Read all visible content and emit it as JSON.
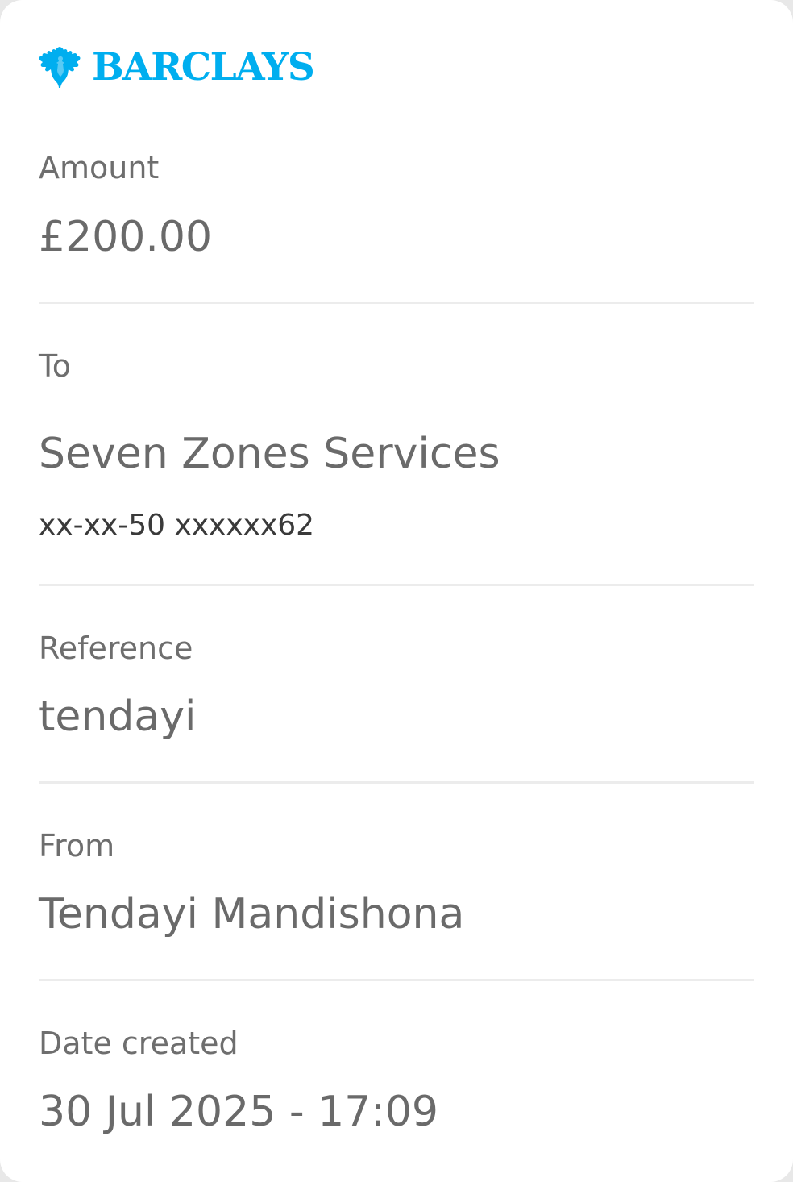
{
  "brand": {
    "name": "BARCLAYS",
    "logo_icon": "barclays-eagle-icon",
    "color": "#00aeef"
  },
  "amount": {
    "label": "Amount",
    "value": "£200.00"
  },
  "to": {
    "label": "To",
    "name": "Seven Zones Services",
    "account": "xx-xx-50 xxxxxx62"
  },
  "reference": {
    "label": "Reference",
    "value": "tendayi"
  },
  "from": {
    "label": "From",
    "value": "Tendayi Mandishona"
  },
  "date_created": {
    "label": "Date created",
    "value": "30 Jul 2025 - 17:09"
  }
}
